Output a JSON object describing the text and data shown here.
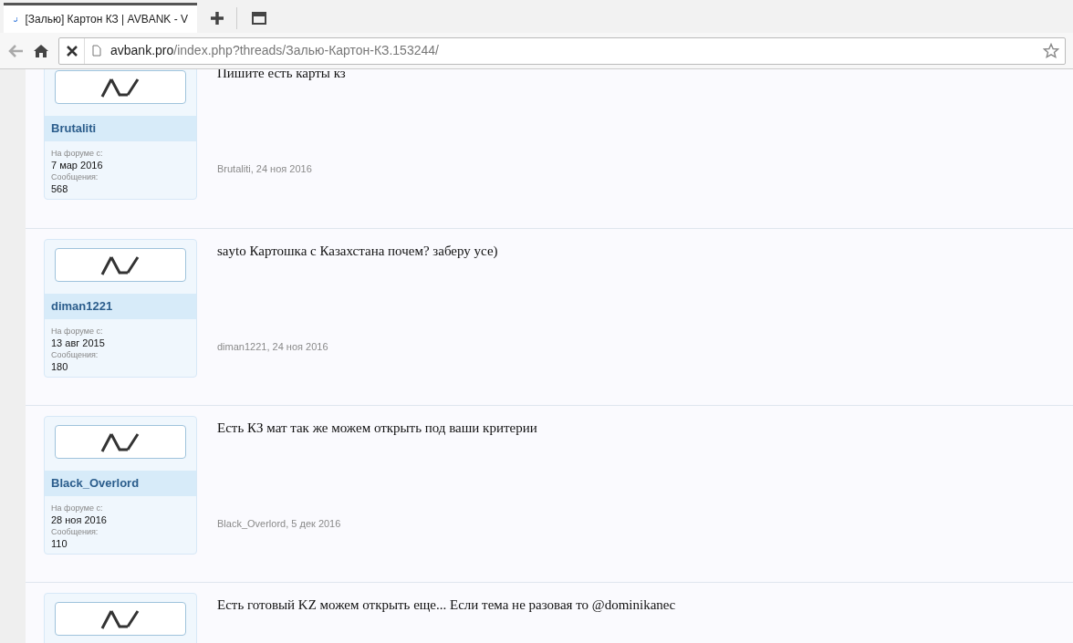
{
  "browser": {
    "tab_title": "[Залью] Картон КЗ | AVBANK - V",
    "url_host": "avbank.pro",
    "url_path": "/index.php?threads/Залью-Картон-КЗ.153244/"
  },
  "posts": [
    {
      "author": "Brutaliti",
      "joined_label": "На форуме с:",
      "joined": "7 мар 2016",
      "messages_label": "Сообщения:",
      "messages": "568",
      "text": "Пишите есть карты кз",
      "footer": "Brutaliti, 24 ноя 2016"
    },
    {
      "author": "diman1221",
      "joined_label": "На форуме с:",
      "joined": "13 авг 2015",
      "messages_label": "Сообщения:",
      "messages": "180",
      "text": "sayto Картошка с Казахстана почем? заберу усе)",
      "footer": "diman1221, 24 ноя 2016"
    },
    {
      "author": "Black_Overlord",
      "joined_label": "На форуме с:",
      "joined": "28 ноя 2016",
      "messages_label": "Сообщения:",
      "messages": "110",
      "text": "Есть КЗ мат так же можем открыть под ваши критерии",
      "footer": "Black_Overlord, 5 дек 2016"
    },
    {
      "text": "Есть готовый KZ можем открыть еще... Если тема не разовая то @dominikanec"
    }
  ]
}
